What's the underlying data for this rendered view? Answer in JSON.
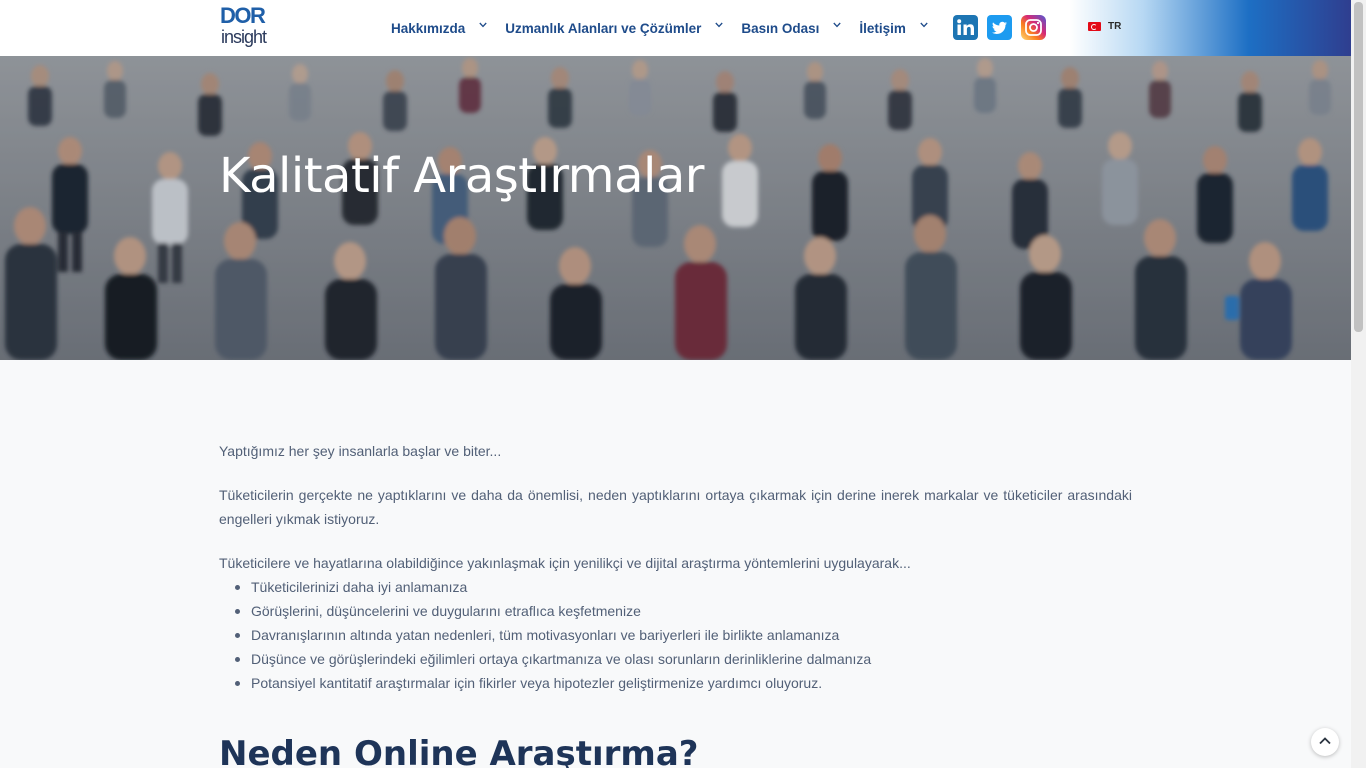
{
  "header": {
    "logo_top": "DOR",
    "logo_bottom": "insight",
    "nav": [
      {
        "label": "Hakkımızda"
      },
      {
        "label": "Uzmanlık Alanları ve Çözümler"
      },
      {
        "label": "Basın Odası"
      },
      {
        "label": "İletişim"
      }
    ],
    "social": [
      "linkedin-icon",
      "twitter-icon",
      "instagram-icon"
    ],
    "language": "TR",
    "colors": {
      "nav_text": "#1e4b8a",
      "gradient_end": "#2f3e8f"
    }
  },
  "hero": {
    "title": "Kalitatif Araştırmalar"
  },
  "content": {
    "intro": "Yaptığımız her şey insanlarla başlar ve biter...",
    "paragraph": "Tüketicilerin gerçekte ne yaptıklarını ve daha da önemlisi, neden yaptıklarını ortaya çıkarmak için derine inerek markalar ve tüketiciler arasındaki engelleri yıkmak istiyoruz.",
    "list_intro": "Tüketicilere ve hayatlarına olabildiğince yakınlaşmak için yenilikçi ve dijital araştırma yöntemlerini uygulayarak...",
    "bullets": [
      "Tüketicilerinizi daha iyi anlamanıza",
      "Görüşlerini, düşüncelerini ve duygularını etraflıca keşfetmenize",
      "Davranışlarının altında yatan nedenleri, tüm motivasyonları ve bariyerleri ile birlikte anlamanıza",
      "Düşünce ve görüşlerindeki eğilimleri ortaya çıkartmanıza ve olası sorunların derinliklerine dalmanıza",
      "Potansiyel kantitatif araştırmalar için fikirler veya hipotezler geliştirmenize yardımcı oluyoruz."
    ],
    "next_heading": "Neden Online Araştırma?"
  }
}
